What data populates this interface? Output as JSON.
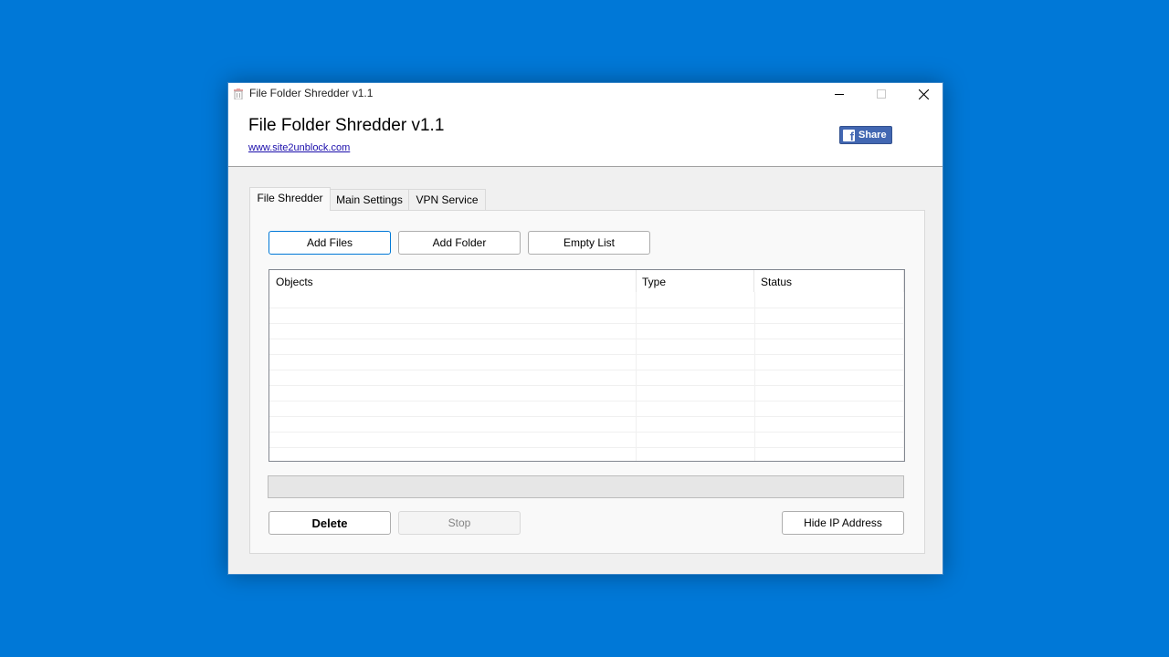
{
  "window": {
    "title": "File Folder Shredder v1.1",
    "icon": "trash-bin-icon",
    "controls": {
      "minimize": "minimize-icon",
      "maximize": "maximize-icon",
      "close": "close-icon"
    }
  },
  "header": {
    "app_title": "File Folder Shredder v1.1",
    "website_link": "www.site2unblock.com",
    "share_button": {
      "label": "Share",
      "icon": "facebook-icon",
      "color": "#4267b2"
    }
  },
  "tabs": [
    {
      "label": "File Shredder",
      "active": true
    },
    {
      "label": "Main Settings",
      "active": false
    },
    {
      "label": "VPN Service",
      "active": false
    }
  ],
  "toolbar": {
    "add_files": "Add Files",
    "add_folder": "Add Folder",
    "empty_list": "Empty List"
  },
  "list": {
    "columns": [
      "Objects",
      "Type",
      "Status"
    ],
    "rows": []
  },
  "progress": {
    "value": 0
  },
  "actions": {
    "delete": "Delete",
    "stop": "Stop",
    "hide_ip": "Hide IP Address"
  },
  "colors": {
    "desktop": "#0078d7",
    "focus_border": "#0078d7",
    "link": "#1a0dab"
  }
}
